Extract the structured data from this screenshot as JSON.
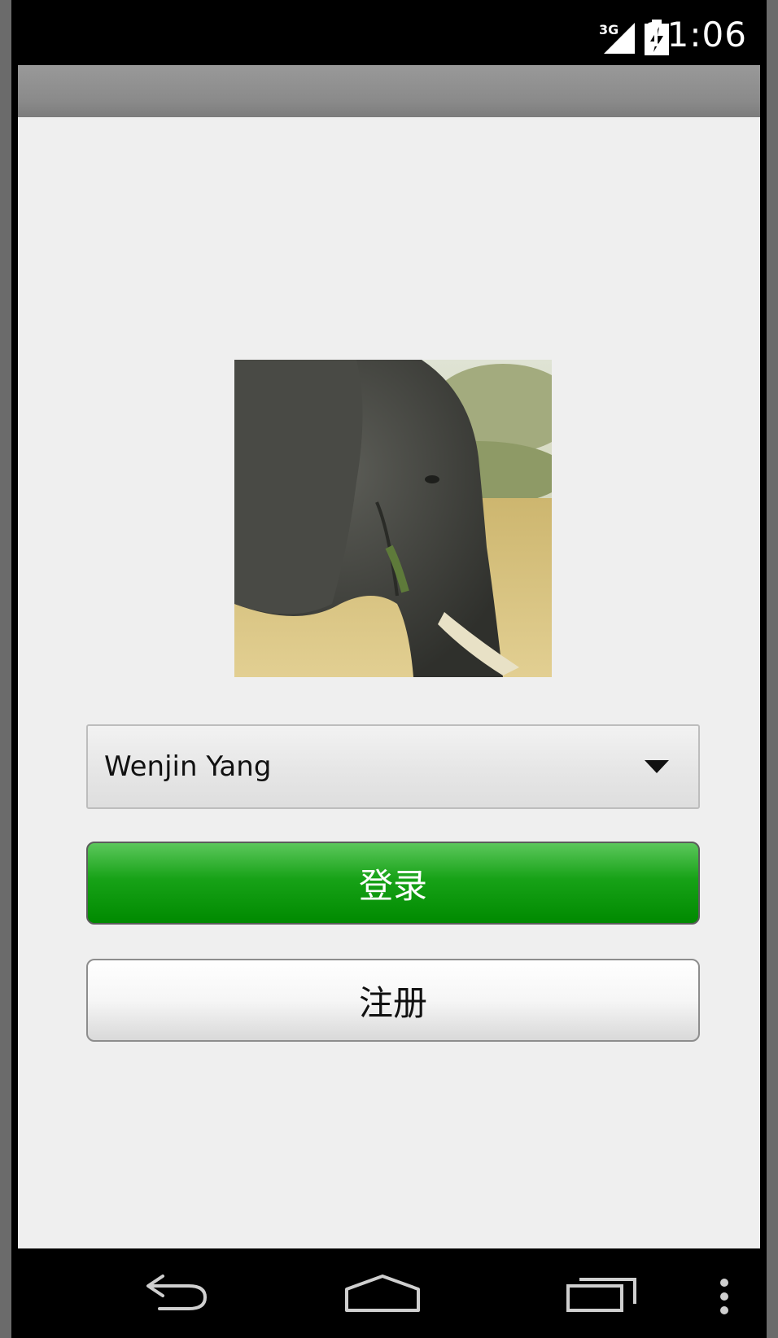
{
  "status_bar": {
    "time": "11:06",
    "network": "3G",
    "icons": [
      "signal-3g-icon",
      "battery-charging-icon"
    ]
  },
  "avatar": {
    "icon": "elephant-photo"
  },
  "account_spinner": {
    "selected": "Wenjin Yang",
    "icon": "dropdown-arrow-icon"
  },
  "buttons": {
    "login_label": "登录",
    "register_label": "注册"
  },
  "colors": {
    "login_green": "#008a00",
    "background": "#efefef"
  },
  "nav_bar": {
    "icons": [
      "back-icon",
      "home-icon",
      "recents-icon",
      "overflow-menu-icon"
    ]
  }
}
